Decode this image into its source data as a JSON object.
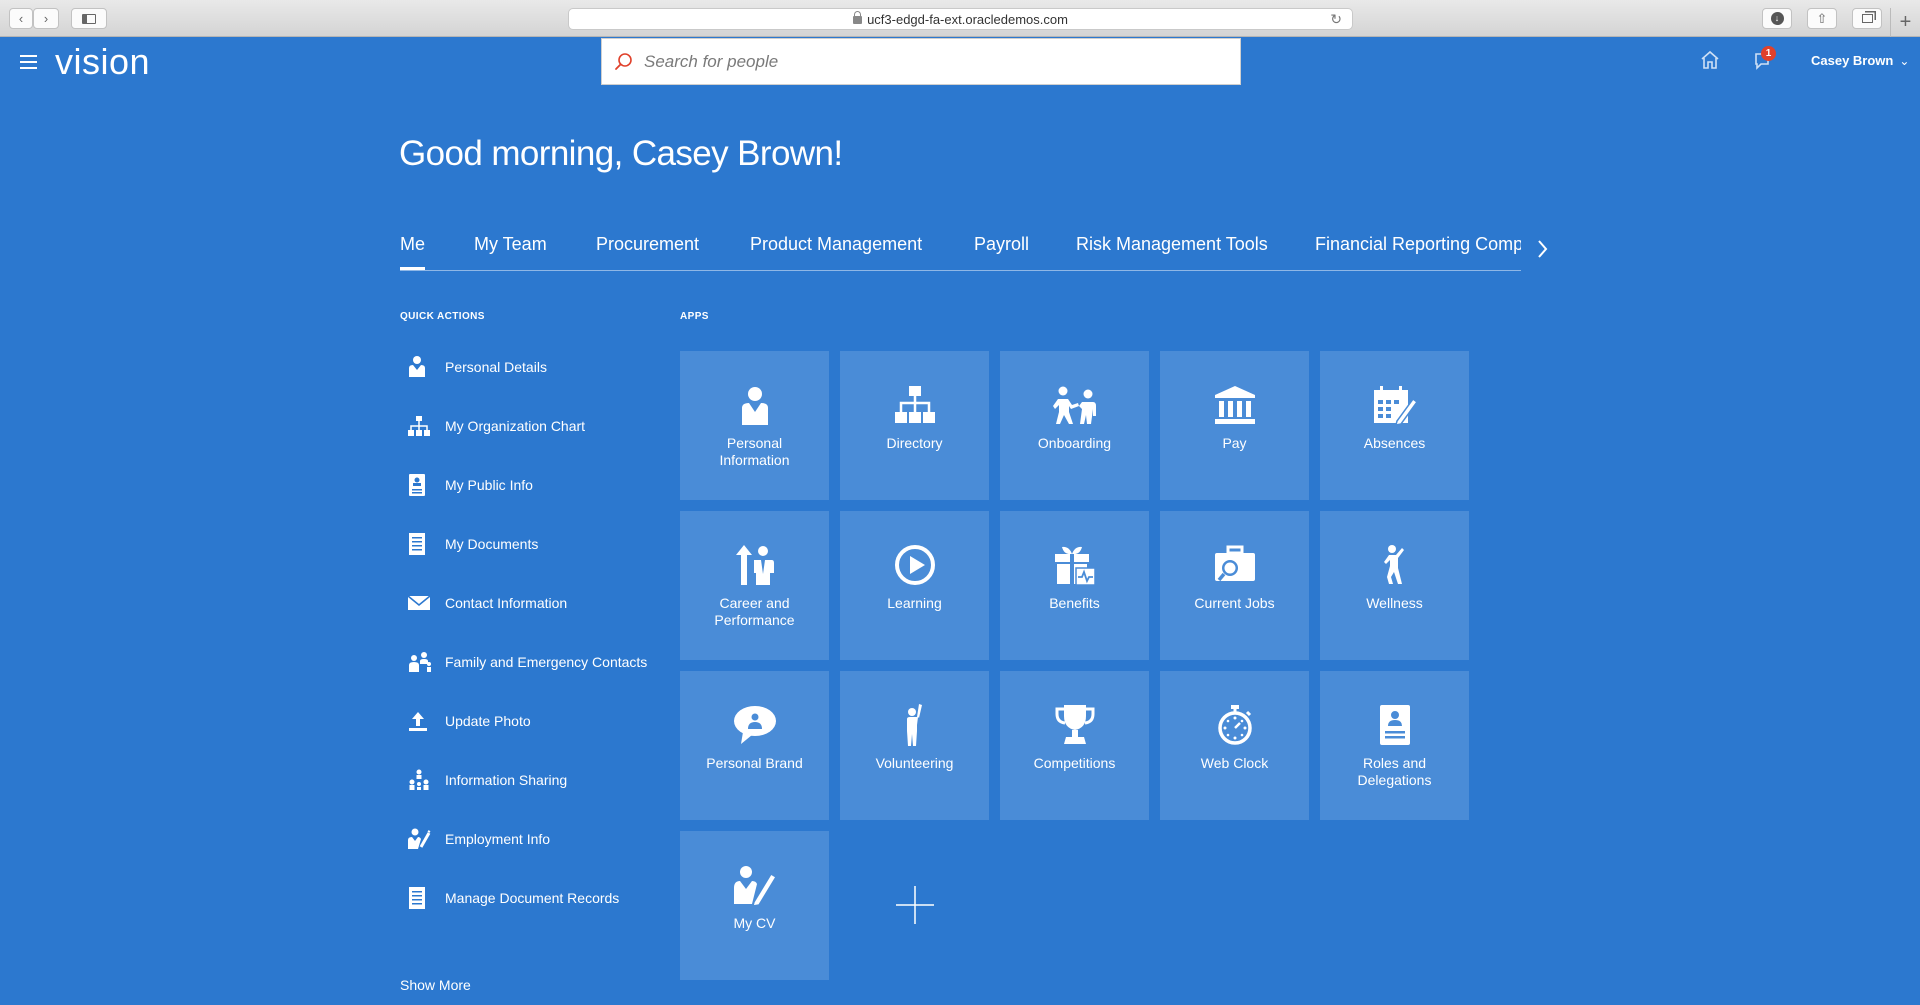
{
  "browser": {
    "url": "ucf3-edgd-fa-ext.oracledemos.com"
  },
  "header": {
    "logo": "vision",
    "search_placeholder": "Search for people",
    "notification_count": "1",
    "user_name": "Casey Brown"
  },
  "greeting": "Good morning, Casey Brown!",
  "tabs": [
    {
      "label": "Me",
      "active": true
    },
    {
      "label": "My Team"
    },
    {
      "label": "Procurement"
    },
    {
      "label": "Product Management"
    },
    {
      "label": "Payroll"
    },
    {
      "label": "Risk Management Tools"
    },
    {
      "label": "Financial Reporting Comp"
    }
  ],
  "quick_actions": {
    "title": "QUICK ACTIONS",
    "items": [
      {
        "label": "Personal Details",
        "icon": "person-icon"
      },
      {
        "label": "My Organization Chart",
        "icon": "org-chart-icon"
      },
      {
        "label": "My Public Info",
        "icon": "id-card-icon"
      },
      {
        "label": "My Documents",
        "icon": "document-icon"
      },
      {
        "label": "Contact Information",
        "icon": "envelope-icon"
      },
      {
        "label": "Family and Emergency Contacts",
        "icon": "family-icon"
      },
      {
        "label": "Update Photo",
        "icon": "upload-icon"
      },
      {
        "label": "Information Sharing",
        "icon": "sharing-icon"
      },
      {
        "label": "Employment Info",
        "icon": "employment-icon"
      },
      {
        "label": "Manage Document Records",
        "icon": "document-records-icon"
      }
    ],
    "show_more": "Show More"
  },
  "apps": {
    "title": "APPS",
    "tiles": [
      {
        "label": "Personal Information",
        "icon": "person-icon"
      },
      {
        "label": "Directory",
        "icon": "directory-icon"
      },
      {
        "label": "Onboarding",
        "icon": "onboarding-icon"
      },
      {
        "label": "Pay",
        "icon": "bank-icon"
      },
      {
        "label": "Absences",
        "icon": "calendar-icon"
      },
      {
        "label": "Career and Performance",
        "icon": "career-icon"
      },
      {
        "label": "Learning",
        "icon": "play-icon"
      },
      {
        "label": "Benefits",
        "icon": "gift-icon"
      },
      {
        "label": "Current Jobs",
        "icon": "briefcase-search-icon"
      },
      {
        "label": "Wellness",
        "icon": "wellness-icon"
      },
      {
        "label": "Personal Brand",
        "icon": "speech-bubble-icon"
      },
      {
        "label": "Volunteering",
        "icon": "volunteer-icon"
      },
      {
        "label": "Competitions",
        "icon": "trophy-icon"
      },
      {
        "label": "Web Clock",
        "icon": "stopwatch-icon"
      },
      {
        "label": "Roles and Delegations",
        "icon": "badge-icon"
      },
      {
        "label": "My CV",
        "icon": "cv-icon"
      }
    ]
  }
}
